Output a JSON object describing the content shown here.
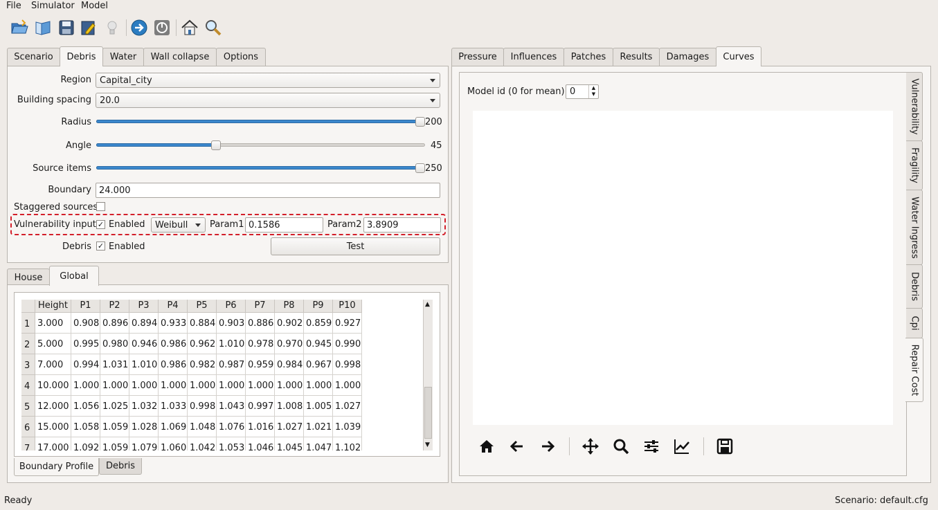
{
  "menu": [
    "File",
    "Simulator",
    "Model"
  ],
  "toolbar_icons": [
    "open-folder-icon",
    "book-icon",
    "save-icon",
    "edit-icon",
    "bulb-icon",
    "run-icon",
    "stop-icon",
    "home-icon",
    "search-icon"
  ],
  "left_tabs": [
    "Scenario",
    "Debris",
    "Water",
    "Wall collapse",
    "Options"
  ],
  "left_active_tab": "Debris",
  "form": {
    "region_label": "Region",
    "region_value": "Capital_city",
    "spacing_label": "Building spacing",
    "spacing_value": "20.0",
    "radius_label": "Radius",
    "radius_value": "200",
    "radius_level": 1.0,
    "angle_label": "Angle",
    "angle_value": "45",
    "angle_level": 0.36,
    "source_label": "Source items",
    "source_value": "250",
    "source_level": 1.0,
    "boundary_label": "Boundary",
    "boundary_value": "24.000",
    "staggered_label": "Staggered sources",
    "vuln_label": "Vulnerability input",
    "vuln_enabled_label": "Enabled",
    "vuln_dist": "Weibull",
    "param1_label": "Param1",
    "param1_value": "0.1586",
    "param2_label": "Param2",
    "param2_value": "3.8909",
    "debris_label": "Debris",
    "debris_enabled_label": "Enabled",
    "check_mark": "✓",
    "test_button": "Test"
  },
  "lower_tabs": [
    "House",
    "Global"
  ],
  "lower_active_tab": "Global",
  "table": {
    "columns": [
      "Height",
      "P1",
      "P2",
      "P3",
      "P4",
      "P5",
      "P6",
      "P7",
      "P8",
      "P9",
      "P10"
    ],
    "rows": [
      {
        "n": "1",
        "cells": [
          "3.000",
          "0.908",
          "0.896",
          "0.894",
          "0.933",
          "0.884",
          "0.903",
          "0.886",
          "0.902",
          "0.859",
          "0.927"
        ]
      },
      {
        "n": "2",
        "cells": [
          "5.000",
          "0.995",
          "0.980",
          "0.946",
          "0.986",
          "0.962",
          "1.010",
          "0.978",
          "0.970",
          "0.945",
          "0.990"
        ]
      },
      {
        "n": "3",
        "cells": [
          "7.000",
          "0.994",
          "1.031",
          "1.010",
          "0.986",
          "0.982",
          "0.987",
          "0.959",
          "0.984",
          "0.967",
          "0.998"
        ]
      },
      {
        "n": "4",
        "cells": [
          "10.000",
          "1.000",
          "1.000",
          "1.000",
          "1.000",
          "1.000",
          "1.000",
          "1.000",
          "1.000",
          "1.000",
          "1.000"
        ]
      },
      {
        "n": "5",
        "cells": [
          "12.000",
          "1.056",
          "1.025",
          "1.032",
          "1.033",
          "0.998",
          "1.043",
          "0.997",
          "1.008",
          "1.005",
          "1.027"
        ]
      },
      {
        "n": "6",
        "cells": [
          "15.000",
          "1.058",
          "1.059",
          "1.028",
          "1.069",
          "1.048",
          "1.076",
          "1.016",
          "1.027",
          "1.021",
          "1.039"
        ]
      },
      {
        "n": "7",
        "cells": [
          "17.000",
          "1.092",
          "1.059",
          "1.079",
          "1.060",
          "1.042",
          "1.053",
          "1.046",
          "1.045",
          "1.047",
          "1.102"
        ]
      }
    ]
  },
  "bottom_tabs": [
    "Boundary Profile",
    "Debris"
  ],
  "bottom_active_tab": "Boundary Profile",
  "right_tabs": [
    "Pressure",
    "Influences",
    "Patches",
    "Results",
    "Damages",
    "Curves"
  ],
  "right_active_tab": "Curves",
  "model_id_label": "Model id (0 for mean):",
  "model_id_value": "0",
  "side_tabs": [
    "Vulnerability",
    "Fragility",
    "Water Ingress",
    "Debris",
    "Cpi",
    "Repair Cost"
  ],
  "side_active_tab": "Repair Cost",
  "plot_toolbar": [
    "home-icon",
    "back-arrow-icon",
    "forward-arrow-icon",
    "pan-icon",
    "zoom-icon",
    "configure-icon",
    "edit-curve-icon",
    "save-icon"
  ],
  "status_left": "Ready",
  "status_right": "Scenario: default.cfg"
}
